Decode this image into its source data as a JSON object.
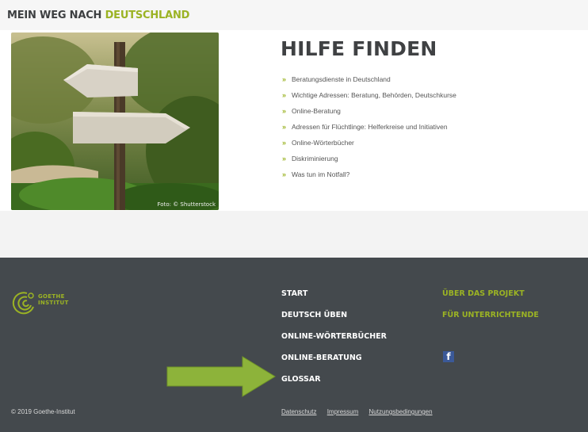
{
  "header": {
    "brand_prefix": "MEIN WEG NACH",
    "brand_accent": "DEUTSCHLAND"
  },
  "hero": {
    "photo_credit": "Foto: © Shutterstock"
  },
  "content": {
    "title": "HILFE FINDEN",
    "links": [
      "Beratungsdienste in Deutschland",
      "Wichtige Adressen: Beratung, Behörden, Deutschkurse",
      "Online-Beratung",
      "Adressen für Flüchtlinge: Helferkreise und Initiativen",
      "Online-Wörterbücher",
      "Diskriminierung",
      "Was tun im Notfall?"
    ],
    "bullet": "»"
  },
  "footer": {
    "logo_line1": "GOETHE",
    "logo_line2": "INSTITUT",
    "nav_main": [
      "START",
      "DEUTSCH ÜBEN",
      "ONLINE-WÖRTERBÜCHER",
      "ONLINE-BERATUNG",
      "GLOSSAR"
    ],
    "nav_secondary": [
      "ÜBER DAS PROJEKT",
      "FÜR UNTERRICHTENDE"
    ],
    "facebook_glyph": "f",
    "copyright": "© 2019 Goethe-Institut",
    "legal": [
      "Datenschutz",
      "Impressum",
      "Nutzungsbedingungen"
    ]
  },
  "colors": {
    "accent_green": "#9bb324",
    "footer_bg": "#44494d",
    "arrow_green": "#8db33a",
    "facebook_blue": "#3b5998"
  }
}
